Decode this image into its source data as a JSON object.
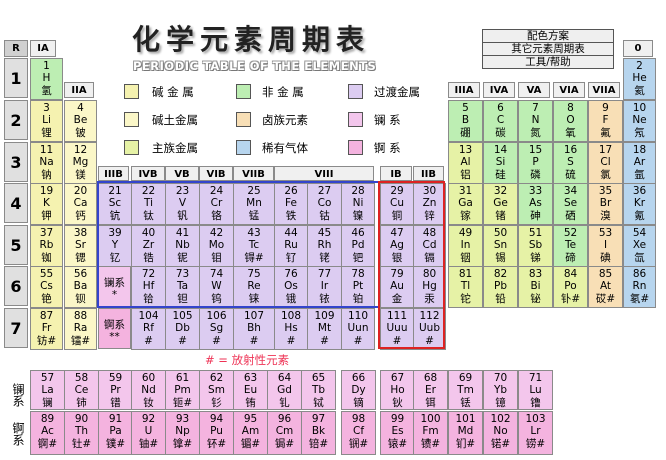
{
  "title": "化学元素周期表",
  "subtitle": "PERIODIC TABLE OF THE ELEMENTS",
  "menu": [
    "配色方案",
    "其它元素周期表",
    "工具/帮助"
  ],
  "corner": {
    "r": "R",
    "ia": "IA",
    "zero": "0"
  },
  "periods": [
    "1",
    "2",
    "3",
    "4",
    "5",
    "6",
    "7"
  ],
  "groups": {
    "IIA": "IIA",
    "IIIB": "IIIB",
    "IVB": "IVB",
    "VB": "VB",
    "VIB": "VIB",
    "VIIB": "VIIB",
    "VIII": "VIII",
    "IB": "IB",
    "IIB": "IIB",
    "IIIA": "IIIA",
    "IVA": "IVA",
    "VA": "VA",
    "VIA": "VIA",
    "VIIA": "VIIA"
  },
  "legend": [
    {
      "label": "碱 金 属",
      "color": "#f5f2b0"
    },
    {
      "label": "非 金 属",
      "color": "#bdeeb3"
    },
    {
      "label": "过渡金属",
      "color": "#dcccf1"
    },
    {
      "label": "碱土金属",
      "color": "#fbf7c8"
    },
    {
      "label": "卤族元素",
      "color": "#f8dfb6"
    },
    {
      "label": "镧    系",
      "color": "#f3c6ec"
    },
    {
      "label": "主族金属",
      "color": "#e6f2a6"
    },
    {
      "label": "稀有气体",
      "color": "#b7d5ee"
    },
    {
      "label": "锕    系",
      "color": "#f4b3df"
    }
  ],
  "radioactive_note": "# = 放射性元素",
  "lan_placeholder": {
    "name": "镧系",
    "mark": "*"
  },
  "act_placeholder": {
    "name": "锕系",
    "mark": "**"
  },
  "lan_row_label": "镧系",
  "act_row_label": "锕系",
  "elements": [
    {
      "n": "1",
      "s": "H",
      "c": "氢",
      "p": 1,
      "g": 1,
      "t": "nonmetal"
    },
    {
      "n": "2",
      "s": "He",
      "c": "氦",
      "p": 1,
      "g": 18,
      "t": "noble"
    },
    {
      "n": "3",
      "s": "Li",
      "c": "锂",
      "p": 2,
      "g": 1,
      "t": "alkali"
    },
    {
      "n": "4",
      "s": "Be",
      "c": "铍",
      "p": 2,
      "g": 2,
      "t": "alkearth"
    },
    {
      "n": "5",
      "s": "B",
      "c": "硼",
      "p": 2,
      "g": 13,
      "t": "nonmetal"
    },
    {
      "n": "6",
      "s": "C",
      "c": "碳",
      "p": 2,
      "g": 14,
      "t": "nonmetal"
    },
    {
      "n": "7",
      "s": "N",
      "c": "氮",
      "p": 2,
      "g": 15,
      "t": "nonmetal"
    },
    {
      "n": "8",
      "s": "O",
      "c": "氧",
      "p": 2,
      "g": 16,
      "t": "nonmetal"
    },
    {
      "n": "9",
      "s": "F",
      "c": "氟",
      "p": 2,
      "g": 17,
      "t": "halogen"
    },
    {
      "n": "10",
      "s": "Ne",
      "c": "氖",
      "p": 2,
      "g": 18,
      "t": "noble"
    },
    {
      "n": "11",
      "s": "Na",
      "c": "钠",
      "p": 3,
      "g": 1,
      "t": "alkali"
    },
    {
      "n": "12",
      "s": "Mg",
      "c": "镁",
      "p": 3,
      "g": 2,
      "t": "alkearth"
    },
    {
      "n": "13",
      "s": "Al",
      "c": "铝",
      "p": 3,
      "g": 13,
      "t": "main"
    },
    {
      "n": "14",
      "s": "Si",
      "c": "硅",
      "p": 3,
      "g": 14,
      "t": "nonmetal"
    },
    {
      "n": "15",
      "s": "P",
      "c": "磷",
      "p": 3,
      "g": 15,
      "t": "nonmetal"
    },
    {
      "n": "16",
      "s": "S",
      "c": "硫",
      "p": 3,
      "g": 16,
      "t": "nonmetal"
    },
    {
      "n": "17",
      "s": "Cl",
      "c": "氯",
      "p": 3,
      "g": 17,
      "t": "halogen"
    },
    {
      "n": "18",
      "s": "Ar",
      "c": "氩",
      "p": 3,
      "g": 18,
      "t": "noble"
    },
    {
      "n": "19",
      "s": "K",
      "c": "钾",
      "p": 4,
      "g": 1,
      "t": "alkali"
    },
    {
      "n": "20",
      "s": "Ca",
      "c": "钙",
      "p": 4,
      "g": 2,
      "t": "alkearth"
    },
    {
      "n": "21",
      "s": "Sc",
      "c": "钪",
      "p": 4,
      "g": 3,
      "t": "trans"
    },
    {
      "n": "22",
      "s": "Ti",
      "c": "钛",
      "p": 4,
      "g": 4,
      "t": "trans"
    },
    {
      "n": "23",
      "s": "V",
      "c": "钒",
      "p": 4,
      "g": 5,
      "t": "trans"
    },
    {
      "n": "24",
      "s": "Cr",
      "c": "铬",
      "p": 4,
      "g": 6,
      "t": "trans"
    },
    {
      "n": "25",
      "s": "Mn",
      "c": "锰",
      "p": 4,
      "g": 7,
      "t": "trans"
    },
    {
      "n": "26",
      "s": "Fe",
      "c": "铁",
      "p": 4,
      "g": 8,
      "t": "trans"
    },
    {
      "n": "27",
      "s": "Co",
      "c": "钴",
      "p": 4,
      "g": 9,
      "t": "trans"
    },
    {
      "n": "28",
      "s": "Ni",
      "c": "镍",
      "p": 4,
      "g": 10,
      "t": "trans"
    },
    {
      "n": "29",
      "s": "Cu",
      "c": "铜",
      "p": 4,
      "g": 11,
      "t": "trans"
    },
    {
      "n": "30",
      "s": "Zn",
      "c": "锌",
      "p": 4,
      "g": 12,
      "t": "trans"
    },
    {
      "n": "31",
      "s": "Ga",
      "c": "镓",
      "p": 4,
      "g": 13,
      "t": "main"
    },
    {
      "n": "32",
      "s": "Ge",
      "c": "锗",
      "p": 4,
      "g": 14,
      "t": "main"
    },
    {
      "n": "33",
      "s": "As",
      "c": "砷",
      "p": 4,
      "g": 15,
      "t": "nonmetal"
    },
    {
      "n": "34",
      "s": "Se",
      "c": "硒",
      "p": 4,
      "g": 16,
      "t": "nonmetal"
    },
    {
      "n": "35",
      "s": "Br",
      "c": "溴",
      "p": 4,
      "g": 17,
      "t": "halogen"
    },
    {
      "n": "36",
      "s": "Kr",
      "c": "氪",
      "p": 4,
      "g": 18,
      "t": "noble"
    },
    {
      "n": "37",
      "s": "Rb",
      "c": "铷",
      "p": 5,
      "g": 1,
      "t": "alkali"
    },
    {
      "n": "38",
      "s": "Sr",
      "c": "锶",
      "p": 5,
      "g": 2,
      "t": "alkearth"
    },
    {
      "n": "39",
      "s": "Y",
      "c": "钇",
      "p": 5,
      "g": 3,
      "t": "trans"
    },
    {
      "n": "40",
      "s": "Zr",
      "c": "锆",
      "p": 5,
      "g": 4,
      "t": "trans"
    },
    {
      "n": "41",
      "s": "Nb",
      "c": "铌",
      "p": 5,
      "g": 5,
      "t": "trans"
    },
    {
      "n": "42",
      "s": "Mo",
      "c": "钼",
      "p": 5,
      "g": 6,
      "t": "trans"
    },
    {
      "n": "43",
      "s": "Tc",
      "c": "锝#",
      "p": 5,
      "g": 7,
      "t": "trans"
    },
    {
      "n": "44",
      "s": "Ru",
      "c": "钌",
      "p": 5,
      "g": 8,
      "t": "trans"
    },
    {
      "n": "45",
      "s": "Rh",
      "c": "铑",
      "p": 5,
      "g": 9,
      "t": "trans"
    },
    {
      "n": "46",
      "s": "Pd",
      "c": "钯",
      "p": 5,
      "g": 10,
      "t": "trans"
    },
    {
      "n": "47",
      "s": "Ag",
      "c": "银",
      "p": 5,
      "g": 11,
      "t": "trans"
    },
    {
      "n": "48",
      "s": "Cd",
      "c": "镉",
      "p": 5,
      "g": 12,
      "t": "trans"
    },
    {
      "n": "49",
      "s": "In",
      "c": "铟",
      "p": 5,
      "g": 13,
      "t": "main"
    },
    {
      "n": "50",
      "s": "Sn",
      "c": "锡",
      "p": 5,
      "g": 14,
      "t": "main"
    },
    {
      "n": "51",
      "s": "Sb",
      "c": "锑",
      "p": 5,
      "g": 15,
      "t": "main"
    },
    {
      "n": "52",
      "s": "Te",
      "c": "碲",
      "p": 5,
      "g": 16,
      "t": "nonmetal"
    },
    {
      "n": "53",
      "s": "I",
      "c": "碘",
      "p": 5,
      "g": 17,
      "t": "halogen"
    },
    {
      "n": "54",
      "s": "Xe",
      "c": "氙",
      "p": 5,
      "g": 18,
      "t": "noble"
    },
    {
      "n": "55",
      "s": "Cs",
      "c": "铯",
      "p": 6,
      "g": 1,
      "t": "alkali"
    },
    {
      "n": "56",
      "s": "Ba",
      "c": "钡",
      "p": 6,
      "g": 2,
      "t": "alkearth"
    },
    {
      "n": "72",
      "s": "Hf",
      "c": "铪",
      "p": 6,
      "g": 4,
      "t": "trans"
    },
    {
      "n": "73",
      "s": "Ta",
      "c": "钽",
      "p": 6,
      "g": 5,
      "t": "trans"
    },
    {
      "n": "74",
      "s": "W",
      "c": "钨",
      "p": 6,
      "g": 6,
      "t": "trans"
    },
    {
      "n": "75",
      "s": "Re",
      "c": "铼",
      "p": 6,
      "g": 7,
      "t": "trans"
    },
    {
      "n": "76",
      "s": "Os",
      "c": "锇",
      "p": 6,
      "g": 8,
      "t": "trans"
    },
    {
      "n": "77",
      "s": "Ir",
      "c": "铱",
      "p": 6,
      "g": 9,
      "t": "trans"
    },
    {
      "n": "78",
      "s": "Pt",
      "c": "铂",
      "p": 6,
      "g": 10,
      "t": "trans"
    },
    {
      "n": "79",
      "s": "Au",
      "c": "金",
      "p": 6,
      "g": 11,
      "t": "trans"
    },
    {
      "n": "80",
      "s": "Hg",
      "c": "汞",
      "p": 6,
      "g": 12,
      "t": "trans"
    },
    {
      "n": "81",
      "s": "Tl",
      "c": "铊",
      "p": 6,
      "g": 13,
      "t": "main"
    },
    {
      "n": "82",
      "s": "Pb",
      "c": "铅",
      "p": 6,
      "g": 14,
      "t": "main"
    },
    {
      "n": "83",
      "s": "Bi",
      "c": "铋",
      "p": 6,
      "g": 15,
      "t": "main"
    },
    {
      "n": "84",
      "s": "Po",
      "c": "钋#",
      "p": 6,
      "g": 16,
      "t": "main"
    },
    {
      "n": "85",
      "s": "At",
      "c": "砹#",
      "p": 6,
      "g": 17,
      "t": "halogen"
    },
    {
      "n": "86",
      "s": "Rn",
      "c": "氡#",
      "p": 6,
      "g": 18,
      "t": "noble"
    },
    {
      "n": "87",
      "s": "Fr",
      "c": "钫#",
      "p": 7,
      "g": 1,
      "t": "alkali"
    },
    {
      "n": "88",
      "s": "Ra",
      "c": "镭#",
      "p": 7,
      "g": 2,
      "t": "alkearth"
    },
    {
      "n": "104",
      "s": "Rf",
      "c": "#",
      "p": 7,
      "g": 4,
      "t": "trans"
    },
    {
      "n": "105",
      "s": "Db",
      "c": "#",
      "p": 7,
      "g": 5,
      "t": "trans"
    },
    {
      "n": "106",
      "s": "Sg",
      "c": "#",
      "p": 7,
      "g": 6,
      "t": "trans"
    },
    {
      "n": "107",
      "s": "Bh",
      "c": "#",
      "p": 7,
      "g": 7,
      "t": "trans"
    },
    {
      "n": "108",
      "s": "Hs",
      "c": "#",
      "p": 7,
      "g": 8,
      "t": "trans"
    },
    {
      "n": "109",
      "s": "Mt",
      "c": "#",
      "p": 7,
      "g": 9,
      "t": "trans"
    },
    {
      "n": "110",
      "s": "Uun",
      "c": "#",
      "p": 7,
      "g": 10,
      "t": "trans"
    },
    {
      "n": "111",
      "s": "Uuu",
      "c": "#",
      "p": 7,
      "g": 11,
      "t": "trans"
    },
    {
      "n": "112",
      "s": "Uub",
      "c": "#",
      "p": 7,
      "g": 12,
      "t": "trans"
    }
  ],
  "lanthanides": [
    {
      "n": "57",
      "s": "La",
      "c": "镧"
    },
    {
      "n": "58",
      "s": "Ce",
      "c": "铈"
    },
    {
      "n": "59",
      "s": "Pr",
      "c": "镨"
    },
    {
      "n": "60",
      "s": "Nd",
      "c": "钕"
    },
    {
      "n": "61",
      "s": "Pm",
      "c": "钷#"
    },
    {
      "n": "62",
      "s": "Sm",
      "c": "钐"
    },
    {
      "n": "63",
      "s": "Eu",
      "c": "铕"
    },
    {
      "n": "64",
      "s": "Gd",
      "c": "钆"
    },
    {
      "n": "65",
      "s": "Tb",
      "c": "铽"
    },
    {
      "n": "66",
      "s": "Dy",
      "c": "镝"
    },
    {
      "n": "67",
      "s": "Ho",
      "c": "钬"
    },
    {
      "n": "68",
      "s": "Er",
      "c": "铒"
    },
    {
      "n": "69",
      "s": "Tm",
      "c": "铥"
    },
    {
      "n": "70",
      "s": "Yb",
      "c": "镱"
    },
    {
      "n": "71",
      "s": "Lu",
      "c": "镥"
    }
  ],
  "actinides": [
    {
      "n": "89",
      "s": "Ac",
      "c": "锕#"
    },
    {
      "n": "90",
      "s": "Th",
      "c": "钍#"
    },
    {
      "n": "91",
      "s": "Pa",
      "c": "镤#"
    },
    {
      "n": "92",
      "s": "U",
      "c": "铀#"
    },
    {
      "n": "93",
      "s": "Np",
      "c": "镎#"
    },
    {
      "n": "94",
      "s": "Pu",
      "c": "钚#"
    },
    {
      "n": "95",
      "s": "Am",
      "c": "镅#"
    },
    {
      "n": "96",
      "s": "Cm",
      "c": "锔#"
    },
    {
      "n": "97",
      "s": "Bk",
      "c": "锫#"
    },
    {
      "n": "98",
      "s": "Cf",
      "c": "锎#"
    },
    {
      "n": "99",
      "s": "Es",
      "c": "锿#"
    },
    {
      "n": "100",
      "s": "Fm",
      "c": "镄#"
    },
    {
      "n": "101",
      "s": "Md",
      "c": "钔#"
    },
    {
      "n": "102",
      "s": "No",
      "c": "锘#"
    },
    {
      "n": "103",
      "s": "Lr",
      "c": "铹#"
    }
  ]
}
